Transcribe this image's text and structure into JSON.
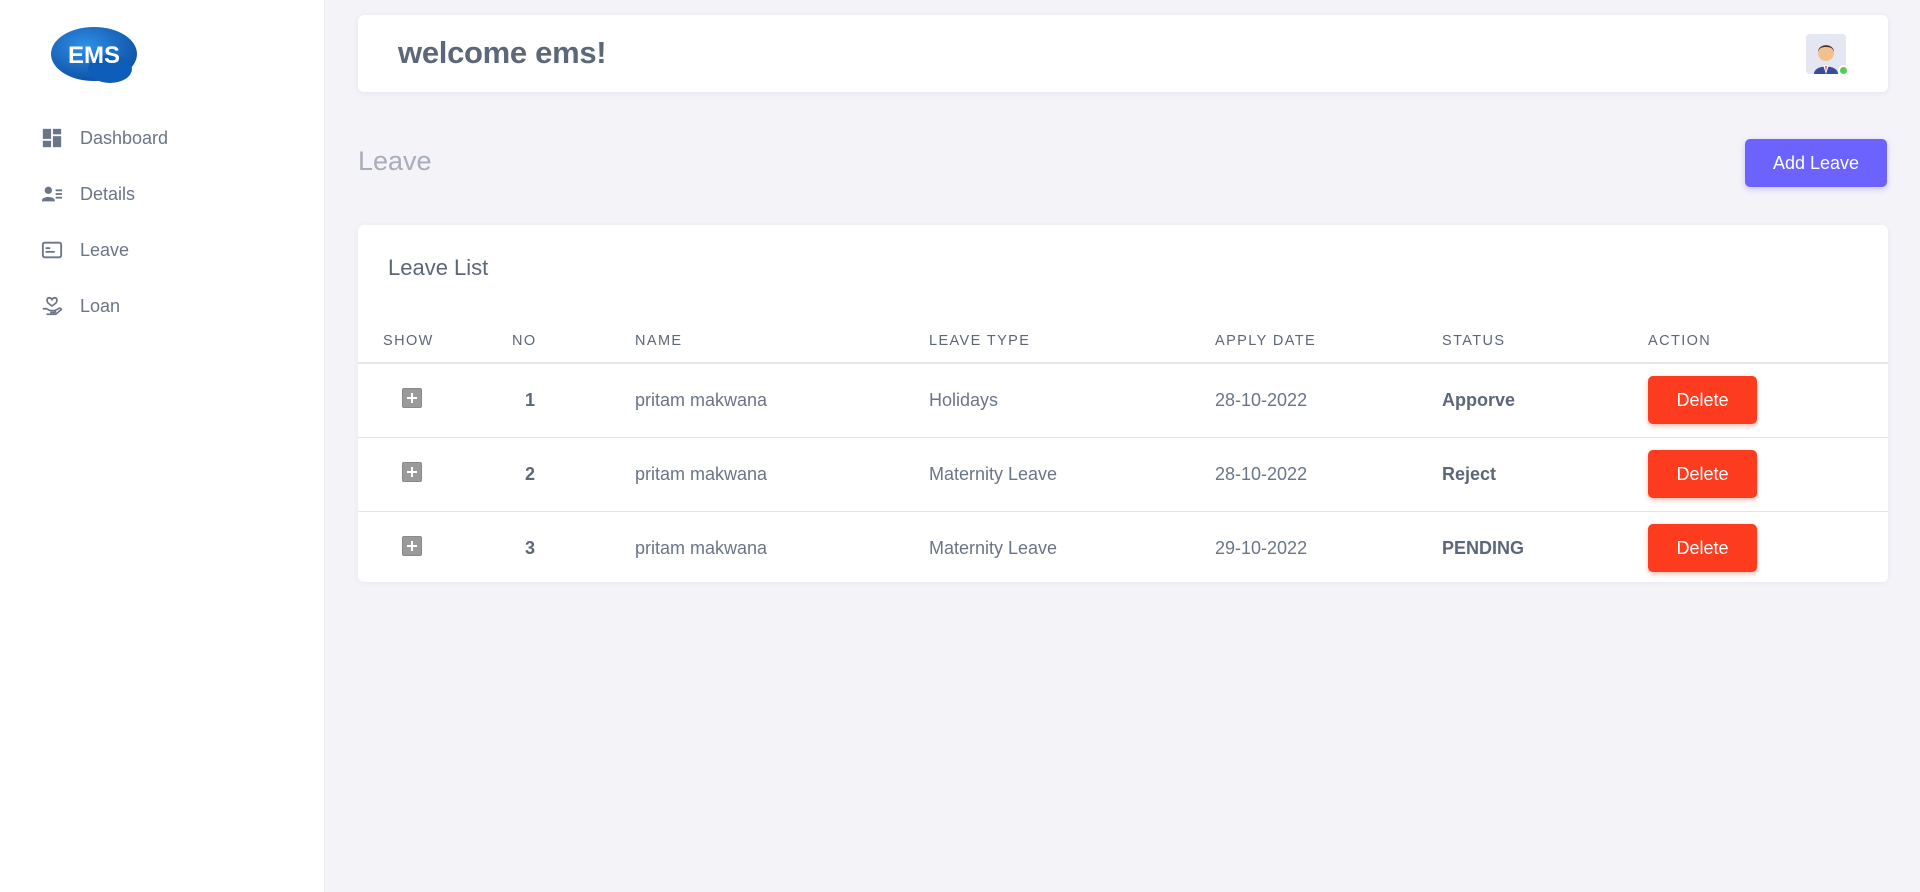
{
  "sidebar": {
    "logo_text": "EMS",
    "items": [
      {
        "label": "Dashboard",
        "icon": "dashboard-icon"
      },
      {
        "label": "Details",
        "icon": "user-details-icon"
      },
      {
        "label": "Leave",
        "icon": "id-card-icon"
      },
      {
        "label": "Loan",
        "icon": "hand-heart-icon"
      }
    ]
  },
  "header": {
    "welcome": "welcome ems!",
    "avatar_icon": "user-avatar-icon",
    "online_status_color": "#4fd14f"
  },
  "page": {
    "title": "Leave",
    "add_button": "Add Leave"
  },
  "card": {
    "title": "Leave List",
    "columns": [
      "SHOW",
      "NO",
      "NAME",
      "LEAVE TYPE",
      "APPLY DATE",
      "STATUS",
      "ACTION"
    ],
    "rows": [
      {
        "no": "1",
        "name": "pritam makwana",
        "leave_type": "Holidays",
        "apply_date": "28-10-2022",
        "status": "Apporve",
        "action": "Delete"
      },
      {
        "no": "2",
        "name": "pritam makwana",
        "leave_type": "Maternity Leave",
        "apply_date": "28-10-2022",
        "status": "Reject",
        "action": "Delete"
      },
      {
        "no": "3",
        "name": "pritam makwana",
        "leave_type": "Maternity Leave",
        "apply_date": "29-10-2022",
        "status": "PENDING",
        "action": "Delete"
      }
    ]
  },
  "colors": {
    "accent": "#6c63ff",
    "danger": "#fc3b1f",
    "background": "#f3f3f8",
    "logo_blue": "#1f6fc8"
  }
}
